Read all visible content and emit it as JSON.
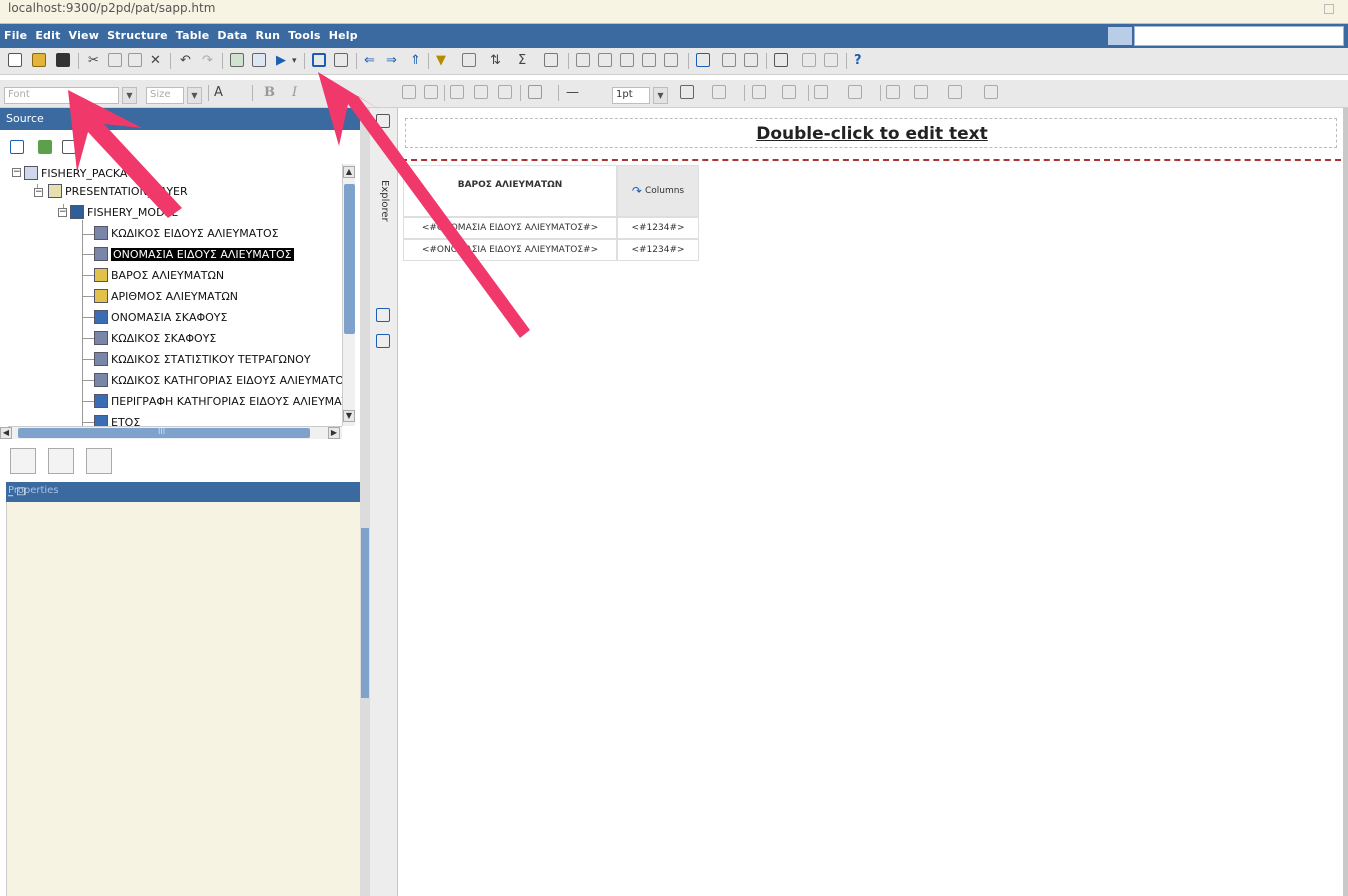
{
  "browser": {
    "url": "localhost:9300/p2pd/pat/sapp.htm"
  },
  "menu": {
    "items": [
      "File",
      "Edit",
      "View",
      "Structure",
      "Table",
      "Data",
      "Run",
      "Tools",
      "Help"
    ]
  },
  "format_toolbar": {
    "font_placeholder": "Font",
    "size_placeholder": "Size",
    "bold_label": "B",
    "italic_label": "I",
    "line_width": "1pt"
  },
  "source_panel": {
    "title": "Source",
    "tree": [
      {
        "label": "FISHERY_PACKAGE",
        "level": 0,
        "icon": "package-icon"
      },
      {
        "label": "PRESENTATION_LAYER",
        "level": 1,
        "icon": "layer-icon"
      },
      {
        "label": "FISHERY_MODEL",
        "level": 2,
        "icon": "model-icon"
      },
      {
        "label": "ΚΩΔΙΚΟΣ ΕΙΔΟΥΣ ΑΛΙΕΥΜΑΤΟΣ",
        "level": 3,
        "icon": "dimension-icon",
        "selected": false
      },
      {
        "label": "ΟΝΟΜΑΣΙΑ ΕΙΔΟΥΣ ΑΛΙΕΥΜΑΤΟΣ",
        "level": 3,
        "icon": "dimension-icon",
        "selected": true
      },
      {
        "label": "ΒΑΡΟΣ ΑΛΙΕΥΜΑΤΩΝ",
        "level": 3,
        "icon": "measure-icon",
        "selected": false
      },
      {
        "label": "ΑΡΙΘΜΟΣ ΑΛΙΕΥΜΑΤΩΝ",
        "level": 3,
        "icon": "measure-icon",
        "selected": false
      },
      {
        "label": "ΟΝΟΜΑΣΙΑ ΣΚΑΦΟΥΣ",
        "level": 3,
        "icon": "attribute-icon",
        "selected": false
      },
      {
        "label": "ΚΩΔΙΚΟΣ ΣΚΑΦΟΥΣ",
        "level": 3,
        "icon": "dimension-icon",
        "selected": false
      },
      {
        "label": "ΚΩΔΙΚΟΣ ΣΤΑΤΙΣΤΙΚΟΥ ΤΕΤΡΑΓΩΝΟΥ",
        "level": 3,
        "icon": "dimension-icon",
        "selected": false
      },
      {
        "label": "ΚΩΔΙΚΟΣ ΚΑΤΗΓΟΡΙΑΣ ΕΙΔΟΥΣ ΑΛΙΕΥΜΑΤΟ",
        "level": 3,
        "icon": "dimension-icon",
        "selected": false
      },
      {
        "label": "ΠΕΡΙΓΡΑΦΗ ΚΑΤΗΓΟΡΙΑΣ ΕΙΔΟΥΣ ΑΛΙΕΥΜΑΤ",
        "level": 3,
        "icon": "attribute-icon",
        "selected": false
      },
      {
        "label": "ΕΤΟΣ",
        "level": 3,
        "icon": "attribute-icon",
        "selected": false
      }
    ],
    "hscroll_label": "III"
  },
  "properties_panel": {
    "title": "Properties",
    "window_controls": "_ □"
  },
  "explorer": {
    "label": "Explorer"
  },
  "report": {
    "title": "Double-click to edit text",
    "crosstab": {
      "measure_header": "ΒΑΡΟΣ ΑΛΙΕΥΜΑΤΩΝ",
      "columns_label": "Columns",
      "rows": [
        {
          "label": "<#ΟΝΟΜΑΣΙΑ ΕΙΔΟΥΣ ΑΛΙΕΥΜΑΤΟΣ#>",
          "value": "<#1234#>"
        },
        {
          "label": "<#ΟΝΟΜΑΣΙΑ ΕΙΔΟΥΣ ΑΛΙΕΥΜΑΤΟΣ#>",
          "value": "<#1234#>"
        }
      ]
    }
  },
  "colors": {
    "accent": "#3a6aa0",
    "arrow": "#f0386b",
    "page_break": "#a33333"
  }
}
